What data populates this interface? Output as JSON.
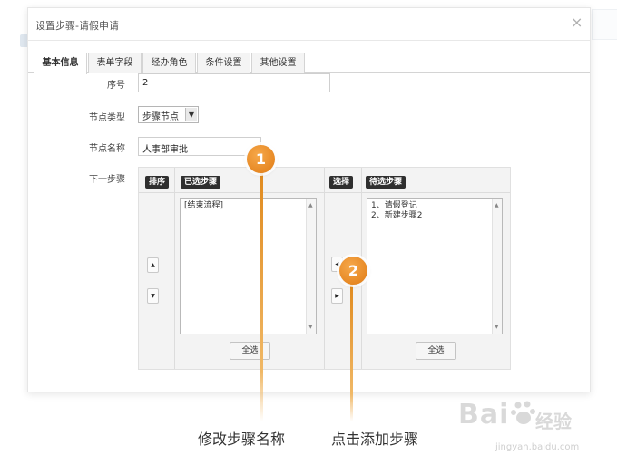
{
  "dialog": {
    "title": "设置步骤-请假申请",
    "close_glyph": "×"
  },
  "tabs": [
    {
      "label": "基本信息",
      "active": true
    },
    {
      "label": "表单字段",
      "active": false
    },
    {
      "label": "经办角色",
      "active": false
    },
    {
      "label": "条件设置",
      "active": false
    },
    {
      "label": "其他设置",
      "active": false
    }
  ],
  "form": {
    "seq_label": "序号",
    "seq_value": "2",
    "node_type_label": "节点类型",
    "node_type_value": "步骤节点",
    "node_name_label": "节点名称",
    "node_name_value": "人事部审批",
    "next_step_label": "下一步骤"
  },
  "steps": {
    "sort_badge": "排序",
    "selected_badge": "已选步骤",
    "choose_badge": "选择",
    "pending_badge": "待选步骤",
    "selected_items": [
      "[结束流程]"
    ],
    "pending_items": [
      "1、请假登记",
      "2、新建步骤2"
    ],
    "select_all_left": "全选",
    "select_all_right": "全选"
  },
  "annotations": [
    {
      "number": "1",
      "caption": "修改步骤名称"
    },
    {
      "number": "2",
      "caption": "点击添加步骤"
    }
  ],
  "watermark": {
    "brand": "Bai",
    "brand_cn": "经验",
    "url": "jingyan.baidu.com"
  },
  "colors": {
    "accent_orange": "#e88a1d",
    "badge_dark": "#2f2f2f",
    "panel_bg": "#f3f3f3"
  }
}
